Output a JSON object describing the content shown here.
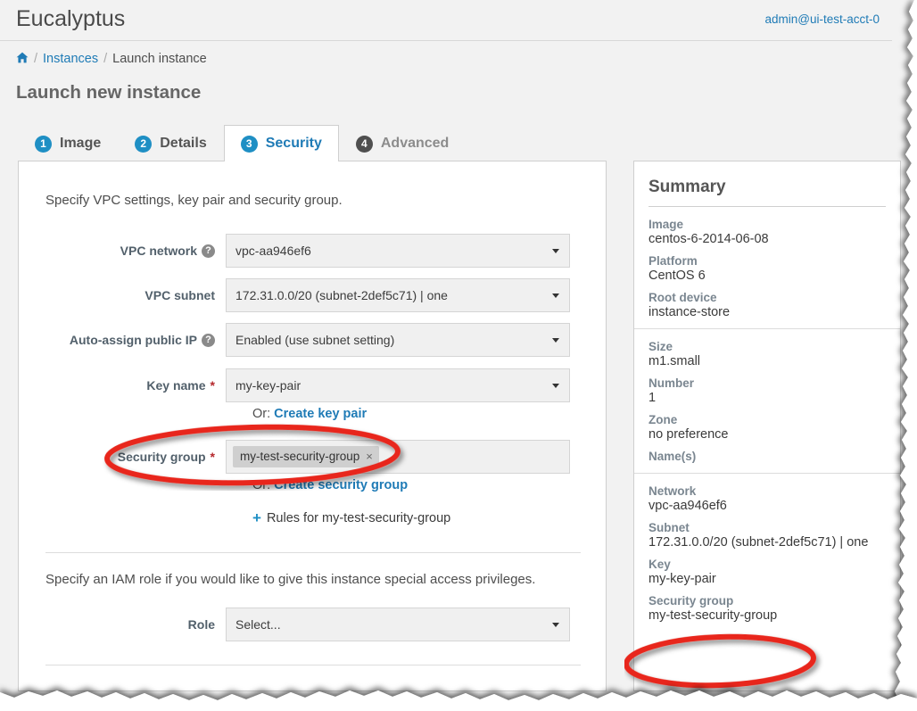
{
  "header": {
    "brand": "Eucalyptus",
    "account": "admin@ui-test-acct-0"
  },
  "breadcrumb": {
    "home_icon": "home-icon",
    "sep": "/",
    "link": "Instances",
    "current": "Launch instance"
  },
  "page_title": "Launch new instance",
  "tabs": [
    {
      "num": "1",
      "label": "Image",
      "active": false
    },
    {
      "num": "2",
      "label": "Details",
      "active": false
    },
    {
      "num": "3",
      "label": "Security",
      "active": true
    },
    {
      "num": "4",
      "label": "Advanced",
      "active": false
    }
  ],
  "form": {
    "intro": "Specify VPC settings, key pair and security group.",
    "vpc_network": {
      "label": "VPC network",
      "help": "?",
      "value": "vpc-aa946ef6"
    },
    "vpc_subnet": {
      "label": "VPC subnet",
      "value": "172.31.0.0/20 (subnet-2def5c71) | one"
    },
    "auto_assign_ip": {
      "label": "Auto-assign public IP",
      "help": "?",
      "value": "Enabled (use subnet setting)"
    },
    "key_name": {
      "label": "Key name",
      "required": "*",
      "value": "my-key-pair",
      "or_prefix": "Or:",
      "or_link": "Create key pair"
    },
    "security_group": {
      "label": "Security group",
      "required": "*",
      "token": "my-test-security-group",
      "token_remove": "×",
      "or_prefix": "Or:",
      "or_link": "Create security group",
      "rules_plus": "+",
      "rules_label": "Rules for my-test-security-group"
    },
    "iam": {
      "text": "Specify an IAM role if you would like to give this instance special access privileges.",
      "role_label": "Role",
      "role_value": "Select..."
    }
  },
  "summary": {
    "title": "Summary",
    "groups": [
      {
        "rows": [
          {
            "key": "Image",
            "value": "centos-6-2014-06-08"
          },
          {
            "key": "Platform",
            "value": "CentOS 6"
          },
          {
            "key": "Root device",
            "value": "instance-store"
          }
        ]
      },
      {
        "rows": [
          {
            "key": "Size",
            "value": "m1.small"
          },
          {
            "key": "Number",
            "value": "1"
          },
          {
            "key": "Zone",
            "value": "no preference"
          },
          {
            "key": "Name(s)",
            "value": ""
          }
        ]
      },
      {
        "rows": [
          {
            "key": "Network",
            "value": "vpc-aa946ef6"
          },
          {
            "key": "Subnet",
            "value": "172.31.0.0/20 (subnet-2def5c71) | one"
          },
          {
            "key": "Key",
            "value": "my-key-pair"
          },
          {
            "key": "Security group",
            "value": "my-test-security-group"
          }
        ]
      }
    ]
  },
  "colors": {
    "accent_blue": "#1f7bb6",
    "step_blue": "#1f8fc4",
    "annotation_red": "#e8251a",
    "label_gray": "#52606b",
    "panel_bg": "#ffffff",
    "page_bg": "#f2f2f2"
  }
}
